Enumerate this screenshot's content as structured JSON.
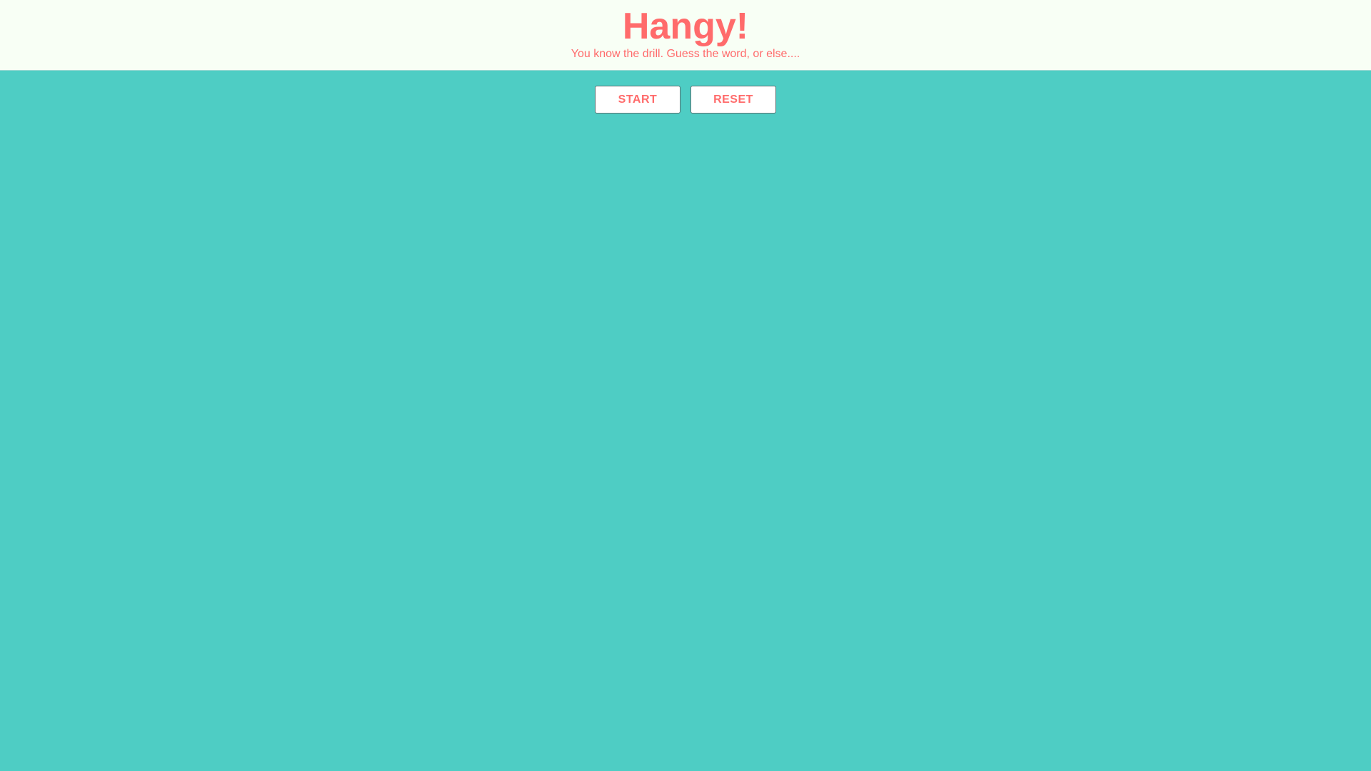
{
  "header": {
    "title": "Hangy!",
    "subtitle": "You know the drill. Guess the word, or else...."
  },
  "controls": {
    "start_label": "START",
    "reset_label": "RESET"
  },
  "colors": {
    "accent": "#ff6b6b",
    "background": "#4ecdc4",
    "header_background": "#f8fff5"
  }
}
